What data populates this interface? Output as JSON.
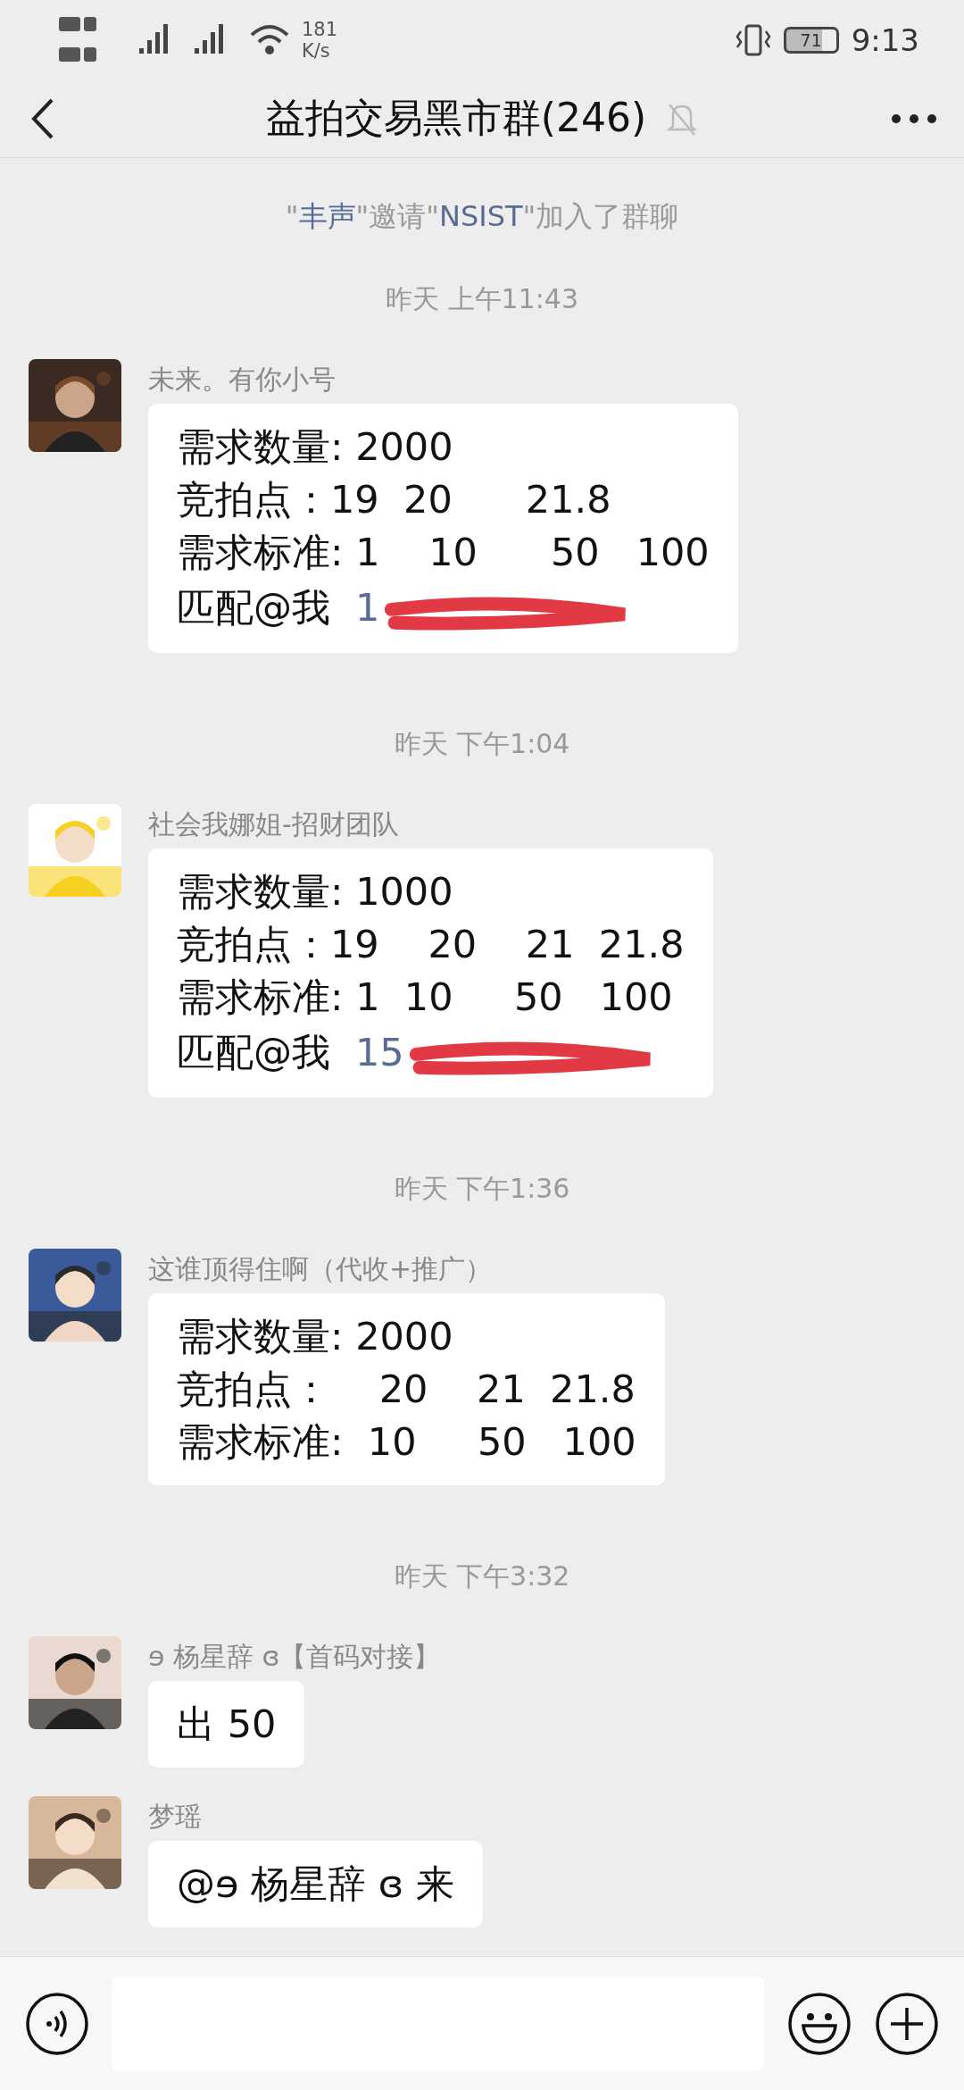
{
  "status_bar": {
    "speed": "181",
    "speed_unit": "K/s",
    "battery": "71",
    "time": "9:13"
  },
  "header": {
    "title": "益拍交易黑市群(246)",
    "muted": true
  },
  "chat": [
    {
      "kind": "system",
      "segments": [
        {
          "text": "\"",
          "highlight": false
        },
        {
          "text": "丰声",
          "highlight": true
        },
        {
          "text": "\"邀请\"",
          "highlight": false
        },
        {
          "text": "NSIST",
          "highlight": true
        },
        {
          "text": "\"加入了群聊",
          "highlight": false
        }
      ]
    },
    {
      "kind": "time",
      "text": "昨天 上午11:43"
    },
    {
      "kind": "message",
      "sender": "未来。有你小号",
      "lines": [
        "需求数量: 2000",
        "竞拍点：19  20      21.8",
        "需求标准: 1    10      50   100"
      ],
      "contact": {
        "label": "匹配@我",
        "link": "1"
      }
    },
    {
      "kind": "time",
      "text": "昨天 下午1:04"
    },
    {
      "kind": "message",
      "sender": "社会我娜姐-招财团队",
      "lines": [
        "需求数量: 1000",
        "竞拍点：19    20    21  21.8",
        "需求标准: 1  10     50   100"
      ],
      "contact": {
        "label": "匹配@我",
        "link": "15"
      }
    },
    {
      "kind": "time",
      "text": "昨天 下午1:36"
    },
    {
      "kind": "message",
      "sender": "这谁顶得住啊（代收+推广）",
      "lines": [
        "需求数量: 2000",
        "竞拍点：    20    21  21.8",
        "需求标准:  10     50   100"
      ]
    },
    {
      "kind": "time",
      "text": "昨天 下午3:32"
    },
    {
      "kind": "message",
      "sender": "ɘ 杨星辞 ɞ【首码对接】",
      "lines": [
        "出 50"
      ]
    },
    {
      "kind": "message",
      "sender": "梦瑶",
      "lines": [
        "@ɘ 杨星辞 ɞ 来"
      ]
    }
  ]
}
